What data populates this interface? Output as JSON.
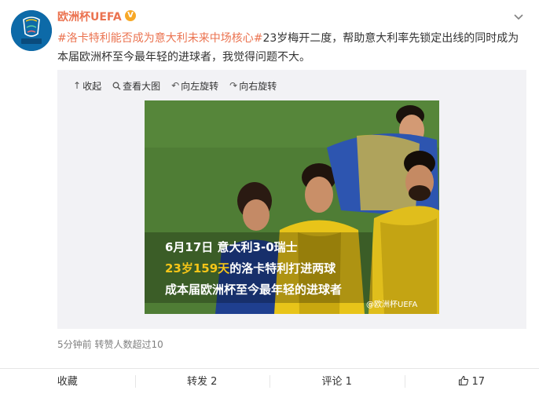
{
  "post": {
    "username": "欧洲杯UEFA",
    "verified_badge": "V",
    "avatar_text": "UEFA EURO2020",
    "topic": "#洛卡特利能否成为意大利未来中场核心#",
    "text": "23岁梅开二度，帮助意大利率先锁定出线的同时成为本届欧洲杯至今最年轻的进球者，我觉得问题不大。",
    "meta": "5分钟前 转赞人数超过10"
  },
  "media_toolbar": {
    "collapse": "收起",
    "view_large": "查看大图",
    "rotate_left": "向左旋转",
    "rotate_right": "向右旋转"
  },
  "photo": {
    "caption_line1": "6月17日 意大利3-0瑞士",
    "caption_line2_highlight": "23岁159天",
    "caption_line2_rest": "的洛卡特利打进两球",
    "caption_line3": "成本届欧洲杯至今最年轻的进球者",
    "watermark": "@欧洲杯UEFA"
  },
  "footer": {
    "favorite": "收藏",
    "repost": "转发 2",
    "comment": "评论 1",
    "like_count": "17"
  },
  "colors": {
    "accent": "#eb7350",
    "caption_highlight": "#f5c518",
    "badge": "#f7a827"
  },
  "icons": [
    "expand-chevron-icon",
    "collapse-icon",
    "magnifier-icon",
    "rotate-left-icon",
    "rotate-right-icon",
    "thumbs-up-icon",
    "verified-badge-icon"
  ]
}
